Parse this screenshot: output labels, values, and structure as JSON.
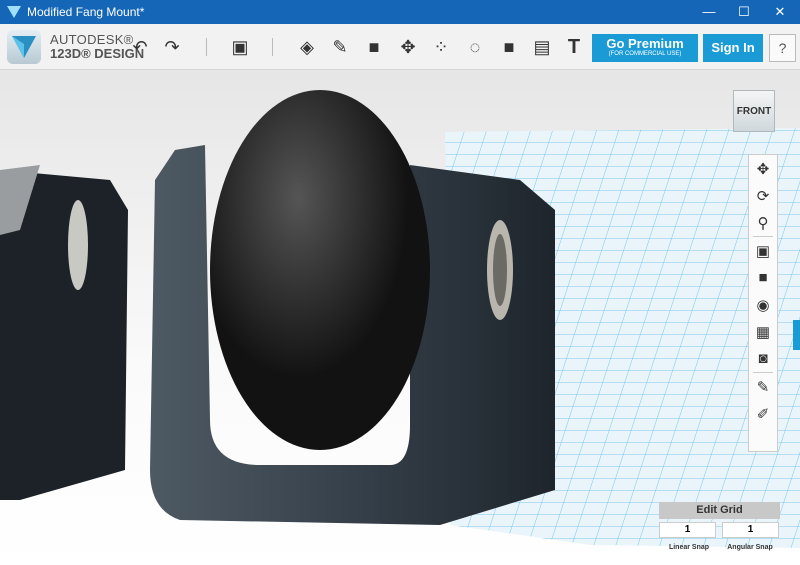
{
  "window": {
    "title": "Modified Fang Mount*",
    "minimize": "—",
    "maximize": "☐",
    "close": "✕"
  },
  "brand": {
    "line1": "AUTODESK®",
    "line2": "123D® DESIGN"
  },
  "toolbar": {
    "undo": "↶",
    "redo": "↷",
    "text_tool": "T",
    "premium_label": "Go Premium",
    "premium_sub": "(FOR COMMERCIAL USE)",
    "signin_label": "Sign In",
    "help_label": "?"
  },
  "viewcube": {
    "label": "FRONT"
  },
  "grid_panel": {
    "title": "Edit Grid",
    "linear_snap_value": "1",
    "linear_snap_label": "Linear Snap",
    "angular_snap_value": "1",
    "angular_snap_label": "Angular Snap"
  },
  "colors": {
    "titlebar": "#1566b7",
    "accent": "#1a9bd6",
    "grid": "#4fb6e4"
  }
}
